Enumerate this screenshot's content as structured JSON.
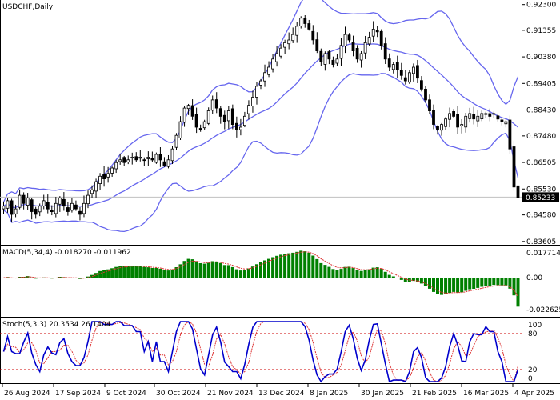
{
  "window": {
    "title": "USDCHF,Daily"
  },
  "colors": {
    "background": "#ffffff",
    "candles": "#000000",
    "bollinger": "#6666ee",
    "macd_histogram": "#008000",
    "macd_signal": "#dd3333",
    "stoch_main": "#0000cc",
    "stoch_signal": "#dd3333",
    "level_lines": "#cc0000",
    "current_price_line": "#c0c0c0",
    "current_price_tag": "#000000"
  },
  "price_axis": {
    "ticks": [
      "0.92300",
      "0.91355",
      "0.90380",
      "0.89405",
      "0.88430",
      "0.87480",
      "0.86505",
      "0.85530",
      "0.84580",
      "0.83605"
    ],
    "current_price": "0.85233"
  },
  "macd_panel": {
    "label": "MACD(5,34,4) -0.018270 -0.011962",
    "ticks": [
      "0.017714",
      "0.00",
      "-0.022625"
    ]
  },
  "stoch_panel": {
    "label": "Stoch(5,3,3) 20.3534 26.1404",
    "ticks": [
      "100",
      "80",
      "20",
      "0"
    ]
  },
  "time_axis": {
    "labels": [
      "26 Aug 2024",
      "17 Sep 2024",
      "9 Oct 2024",
      "30 Oct 2024",
      "21 Nov 2024",
      "13 Dec 2024",
      "8 Jan 2025",
      "30 Jan 2025",
      "21 Feb 2025",
      "16 Mar 2025",
      "4 Apr 2025"
    ]
  },
  "chart_data": [
    {
      "type": "candlestick",
      "title": "USDCHF,Daily",
      "overlays": [
        "Bollinger Bands"
      ],
      "ylim": [
        0.836,
        0.9235
      ],
      "close_series": [
        0.849,
        0.851,
        0.846,
        0.848,
        0.853,
        0.85,
        0.852,
        0.847,
        0.846,
        0.849,
        0.851,
        0.848,
        0.847,
        0.85,
        0.852,
        0.849,
        0.847,
        0.85,
        0.848,
        0.846,
        0.85,
        0.853,
        0.855,
        0.858,
        0.86,
        0.859,
        0.861,
        0.863,
        0.865,
        0.866,
        0.865,
        0.866,
        0.867,
        0.866,
        0.867,
        0.866,
        0.867,
        0.866,
        0.868,
        0.866,
        0.864,
        0.866,
        0.87,
        0.875,
        0.88,
        0.885,
        0.886,
        0.882,
        0.878,
        0.877,
        0.88,
        0.884,
        0.888,
        0.885,
        0.882,
        0.88,
        0.884,
        0.879,
        0.877,
        0.878,
        0.882,
        0.886,
        0.889,
        0.893,
        0.895,
        0.898,
        0.9,
        0.903,
        0.905,
        0.907,
        0.909,
        0.91,
        0.912,
        0.915,
        0.918,
        0.916,
        0.914,
        0.91,
        0.906,
        0.902,
        0.905,
        0.903,
        0.901,
        0.903,
        0.908,
        0.912,
        0.91,
        0.906,
        0.903,
        0.905,
        0.909,
        0.911,
        0.914,
        0.913,
        0.908,
        0.903,
        0.9,
        0.901,
        0.899,
        0.897,
        0.895,
        0.898,
        0.9,
        0.896,
        0.892,
        0.888,
        0.884,
        0.879,
        0.877,
        0.879,
        0.881,
        0.883,
        0.882,
        0.878,
        0.879,
        0.882,
        0.883,
        0.881,
        0.882,
        0.883,
        0.883,
        0.882,
        0.883,
        0.881,
        0.88,
        0.88,
        0.87,
        0.856,
        0.852
      ]
    },
    {
      "type": "bar",
      "title": "MACD(5,34,4)",
      "series": [
        {
          "name": "MACD",
          "last": -0.01827
        },
        {
          "name": "Signal",
          "last": -0.011962
        }
      ],
      "ylim": [
        -0.022625,
        0.017714
      ]
    },
    {
      "type": "line",
      "title": "Stoch(5,3,3)",
      "series": [
        {
          "name": "%K",
          "last": 20.3534
        },
        {
          "name": "%D",
          "last": 26.1404
        }
      ],
      "levels": [
        20,
        80
      ],
      "ylim": [
        0,
        100
      ]
    }
  ]
}
